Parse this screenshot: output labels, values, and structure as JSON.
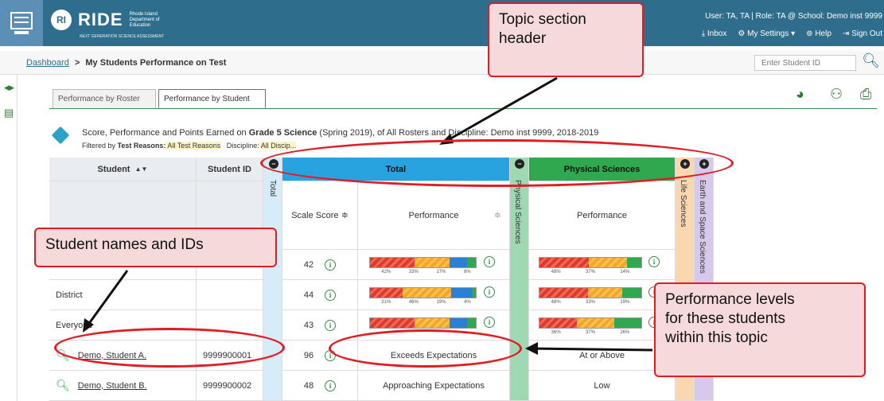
{
  "header": {
    "home_label": "Home",
    "logo_letter": "RI",
    "logo_word": "RIDE",
    "logo_sub": "Rhode Island Department of Education",
    "logo_tag": "NEXT GENERATION SCIENCE ASSESSMENT",
    "user_info": "User: TA, TA  |  Role: TA @ School: Demo inst 9999",
    "inbox": "Inbox",
    "settings": "My Settings ▾",
    "help": "Help",
    "signout": "Sign Out"
  },
  "breadcrumb": {
    "dashboard": "Dashboard",
    "separator": ">",
    "current": "My Students Performance on Test"
  },
  "search": {
    "placeholder": "Enter Student ID",
    "icon": "search-icon"
  },
  "tabs": [
    {
      "label": "Performance by Roster"
    },
    {
      "label": "Performance by Student"
    }
  ],
  "report": {
    "desc_prefix": "Score, Performance and Points Earned on ",
    "test_name": "Grade 5 Science",
    "desc_suffix": " (Spring 2019), of All Rosters and Discipline: Demo inst 9999, 2018-2019",
    "filter_label": "Filtered by ",
    "filter_reasons_label": "Test Reasons:",
    "filter_reasons_value": " All Test Reasons",
    "filter_discipline_label": "Discipline:",
    "filter_discipline_value": " All Discip..."
  },
  "table": {
    "col_student": "Student",
    "col_student_sort": "▲▼",
    "col_student_id": "Student ID",
    "col_total_vertical": "Total",
    "col_total": "Total",
    "col_scale_score": "Scale Score ≑",
    "col_performance": "Performance",
    "col_performance_sort": "≑",
    "col_physical_vertical": "Physical Sciences",
    "col_physical": "Physical Sciences",
    "col_physical_performance": "Performance",
    "col_life_vertical": "Life Sciences",
    "col_earth_vertical": "Earth and Space Sciences",
    "rows": [
      {
        "name": "",
        "id": "",
        "score": "42",
        "total_pcts": [
          "42%",
          "33%",
          "17%",
          "8%"
        ],
        "phys_pcts": [
          "48%",
          "37%",
          "14%"
        ]
      },
      {
        "name": "District",
        "id": "",
        "score": "44",
        "total_pcts": [
          "31%",
          "46%",
          "19%",
          "4%"
        ],
        "phys_pcts": [
          "48%",
          "33%",
          "19%"
        ]
      },
      {
        "name": "Everyone",
        "id": "",
        "score": "43",
        "total_pcts": [
          "",
          "",
          "",
          ""
        ],
        "phys_pcts": [
          "36%",
          "37%",
          "26%"
        ]
      },
      {
        "name": "Demo, Student A.",
        "id": "9999900001",
        "score": "96",
        "total_perf": "Exceeds Expectations",
        "phys_perf": "At or Above"
      },
      {
        "name": "Demo, Student B.",
        "id": "9999900002",
        "score": "48",
        "total_perf": "Approaching Expectations",
        "phys_perf": "Low"
      }
    ]
  },
  "callouts": {
    "topic_header": "Topic section\nheader",
    "student_names": "Student names and IDs",
    "performance_levels": "Performance levels\nfor these students\nwithin this topic"
  },
  "colors": {
    "header": "#2e6e8c",
    "total": "#29a3e0",
    "physical": "#2fa84f",
    "life": "#f9d7b0",
    "earth": "#d7c8ec",
    "callout_border": "#e31b23",
    "callout_fill": "#f5d9db"
  }
}
